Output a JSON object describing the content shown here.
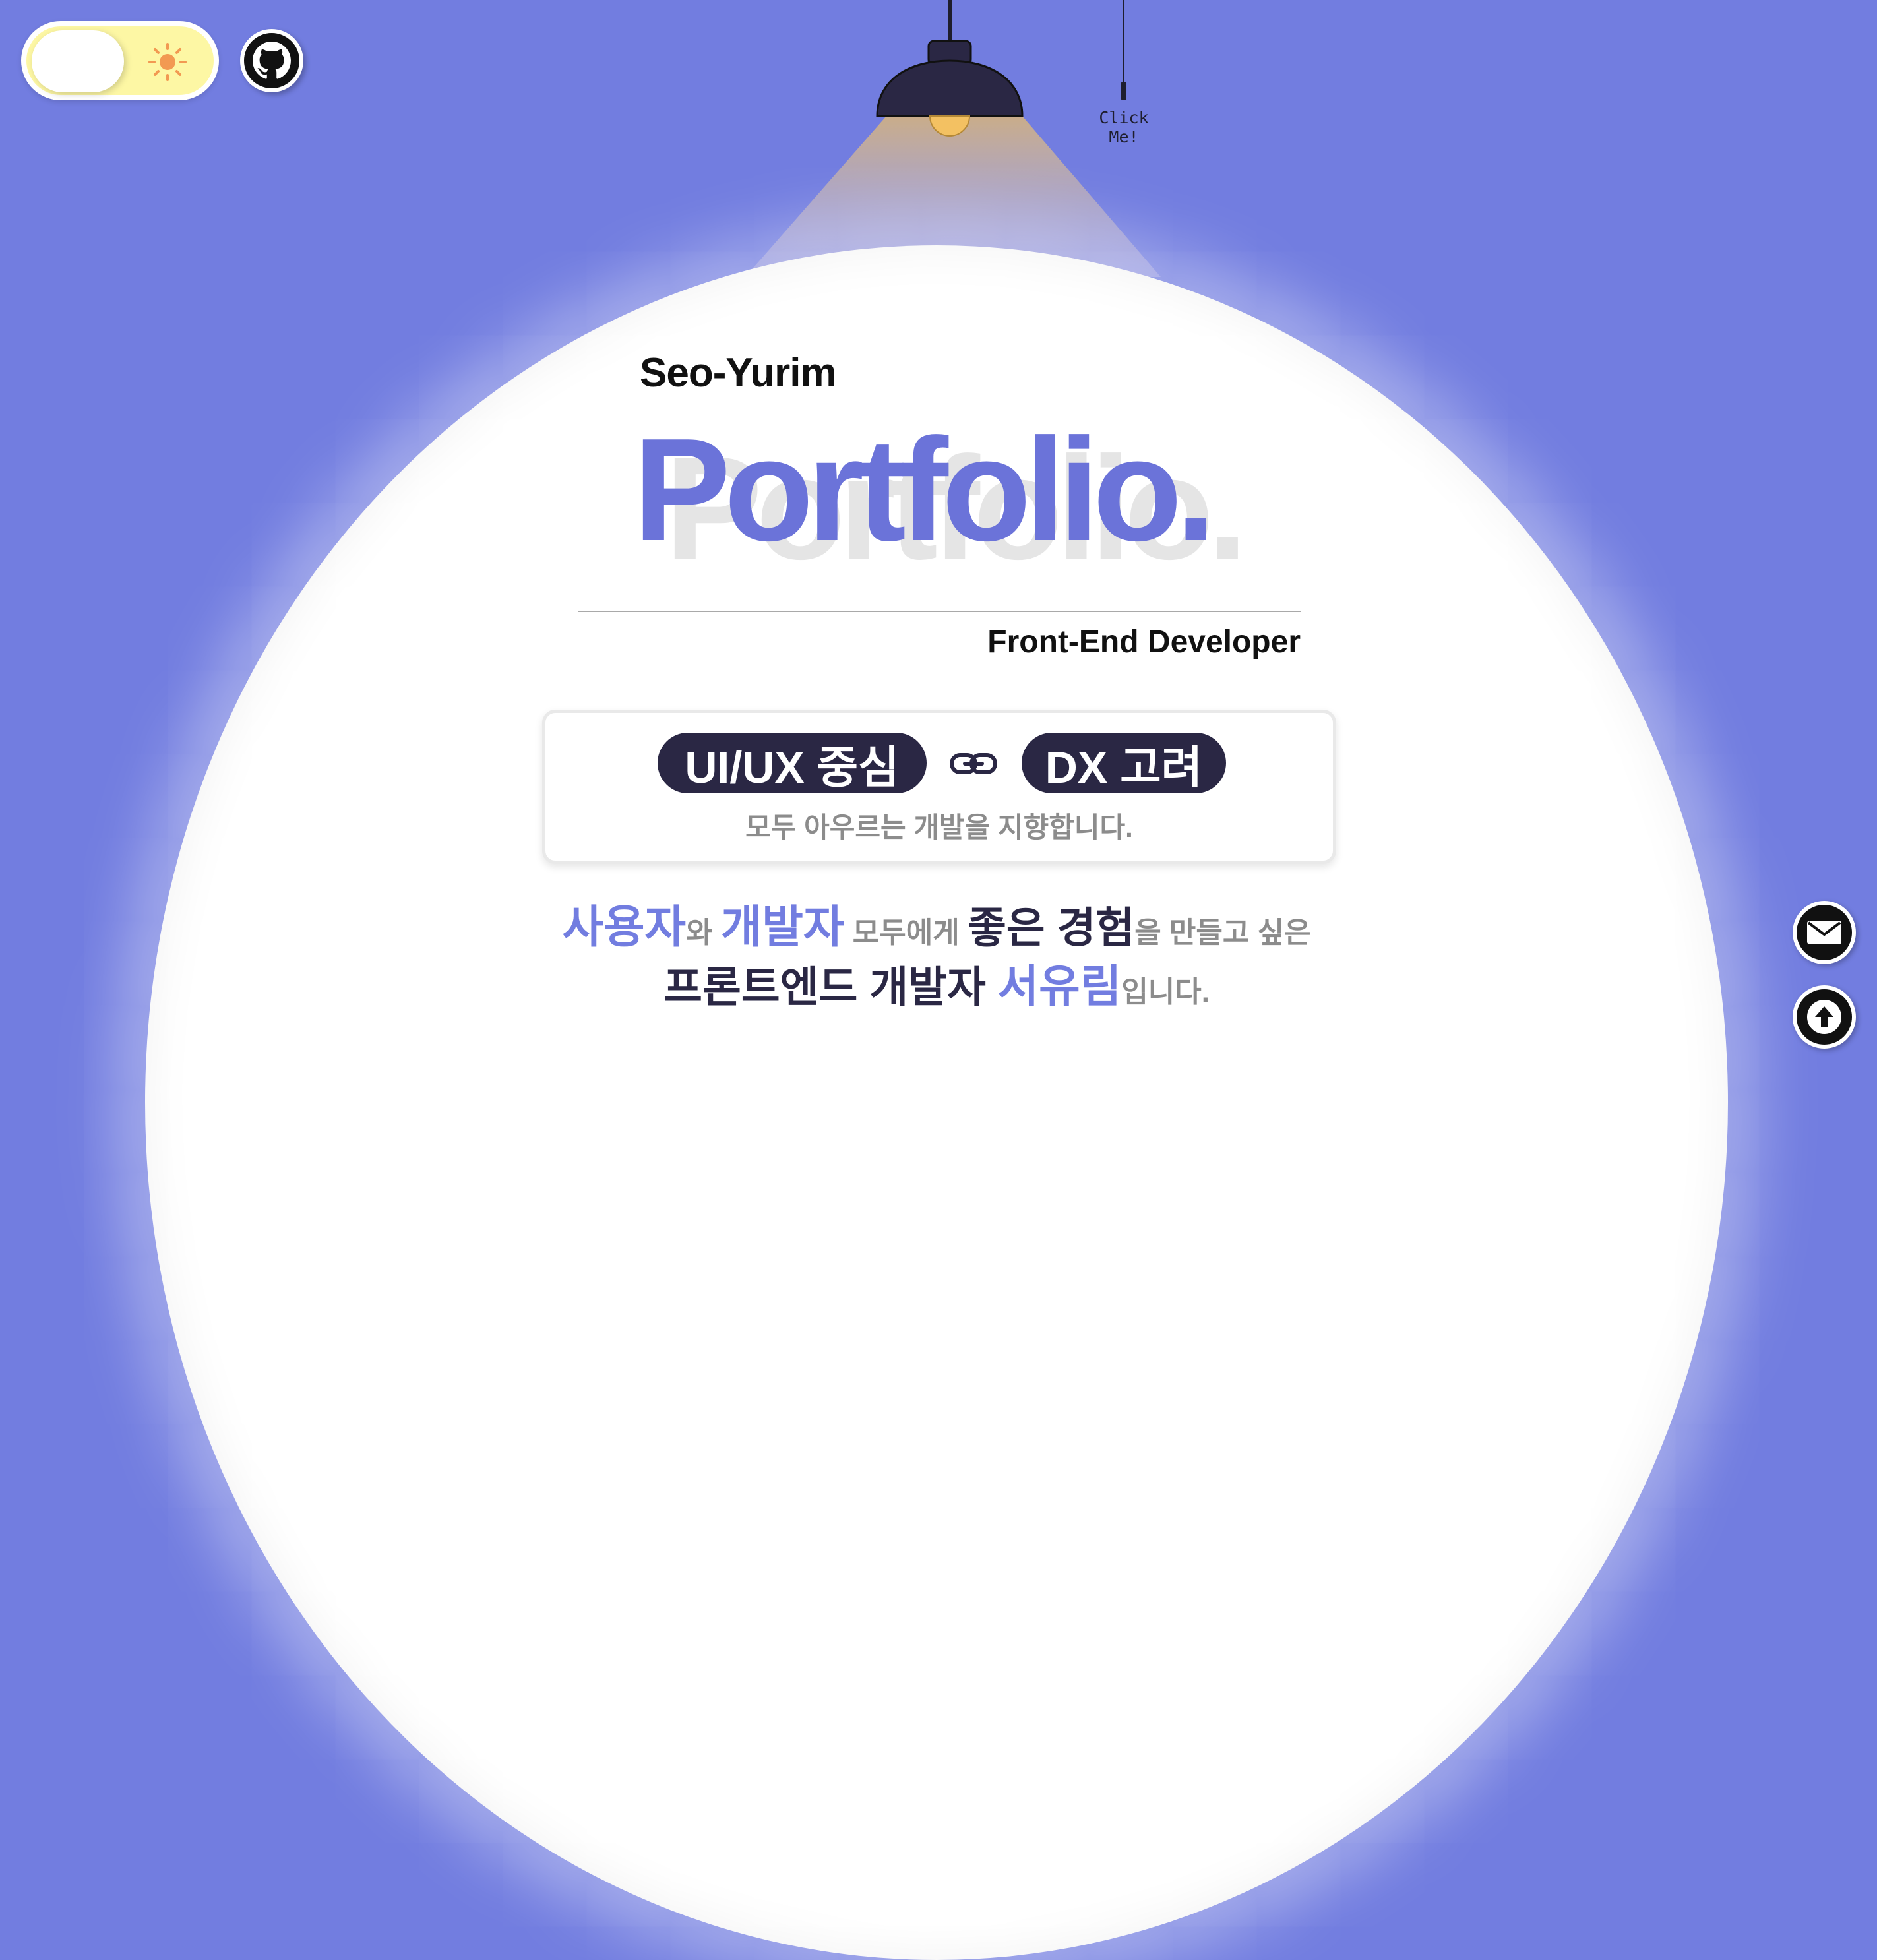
{
  "header": {
    "theme_toggle": {
      "state": "light",
      "icon": "sun-icon",
      "accent": "#fdf7a4"
    },
    "github": {
      "icon": "github-icon"
    }
  },
  "lamp": {
    "click_hint": "Click Me!"
  },
  "hero": {
    "name": "Seo-Yurim",
    "title": "Portfolio.",
    "title_shadow": "Portfolio.",
    "role": "Front-End Developer"
  },
  "card": {
    "pill_left": "UI/UX 중심",
    "pill_right": "DX 고려",
    "link_icon": "link-icon",
    "subtitle": "모두 아우르는 개발을 지향합니다."
  },
  "intro": {
    "line1": [
      {
        "text": "사용자",
        "style": "hl"
      },
      {
        "text": "와 ",
        "style": "gr"
      },
      {
        "text": "개발자",
        "style": "hl"
      },
      {
        "text": " 모두에게 ",
        "style": "gr"
      },
      {
        "text": "좋은 경험",
        "style": "dk"
      },
      {
        "text": "을 만들고 싶은",
        "style": "gr"
      }
    ],
    "line2": [
      {
        "text": "프론트엔드 개발자 ",
        "style": "dk"
      },
      {
        "text": "서유림",
        "style": "hl"
      },
      {
        "text": "입니다.",
        "style": "gr"
      }
    ]
  },
  "floating": {
    "mail_icon": "mail-icon",
    "top_icon": "arrow-up-icon"
  },
  "colors": {
    "background": "#727de0",
    "accent": "#6b73d9",
    "dark": "#2a2744",
    "muted": "#8c8c8c"
  }
}
